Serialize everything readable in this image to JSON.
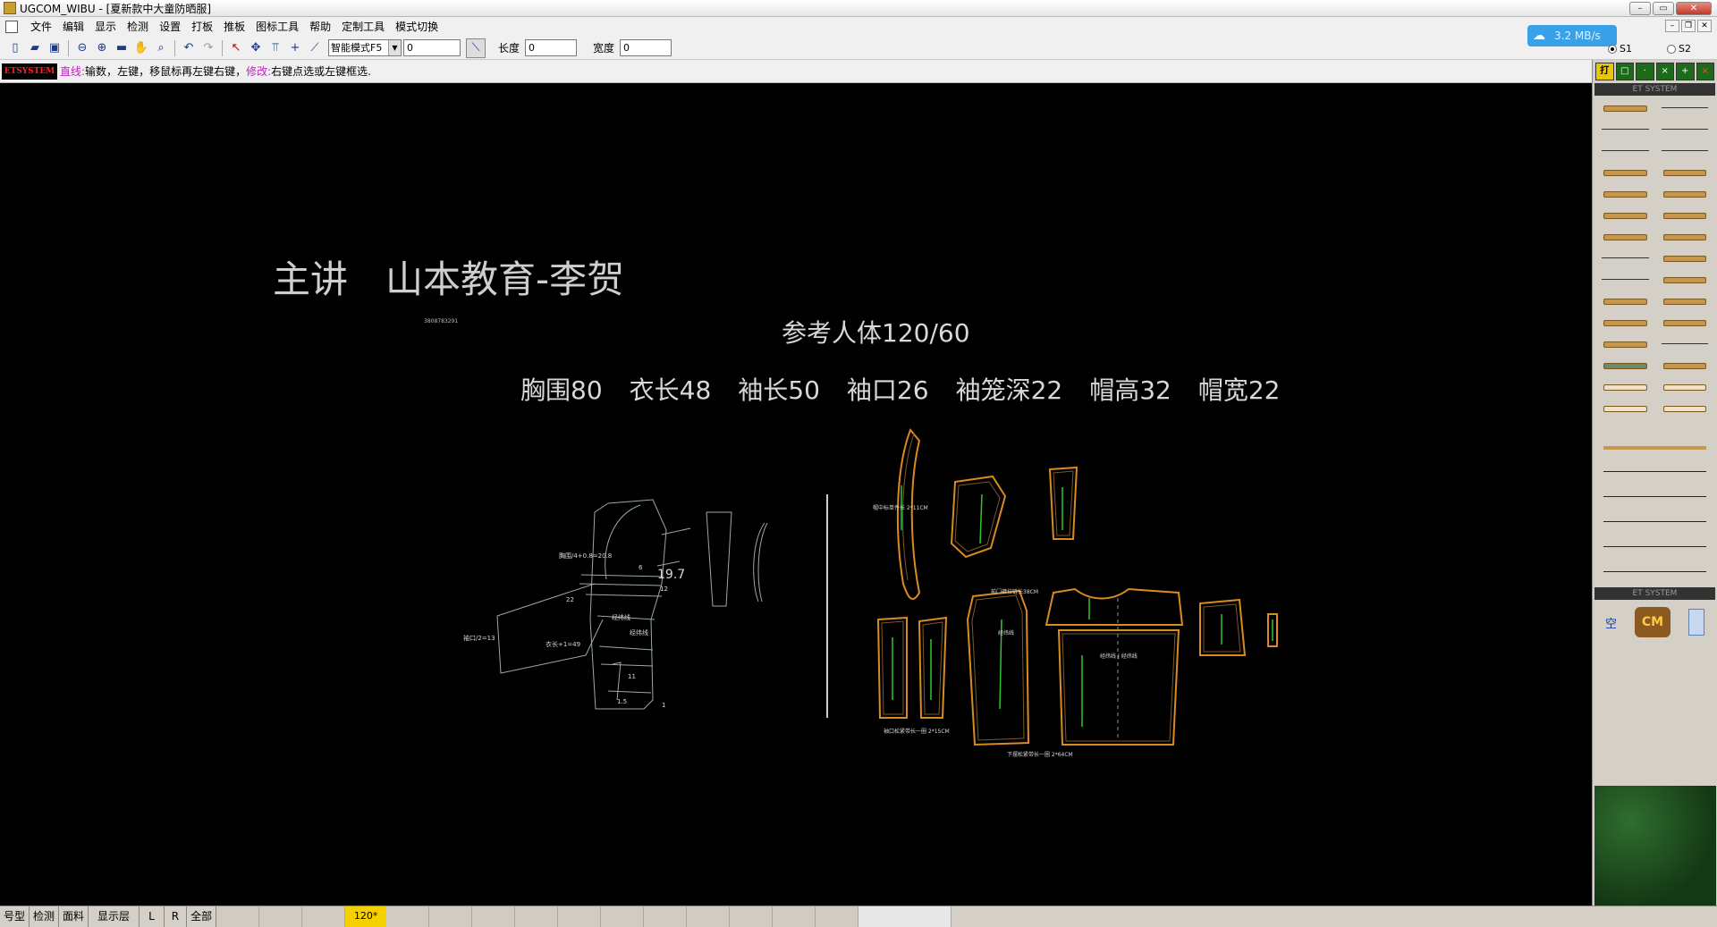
{
  "window": {
    "title": "UGCOM_WIBU - [夏新款中大童防晒服]"
  },
  "menu": [
    "文件",
    "编辑",
    "显示",
    "检测",
    "设置",
    "打板",
    "推板",
    "图标工具",
    "帮助",
    "定制工具",
    "模式切换"
  ],
  "toolbar": {
    "mode_select": "智能模式F5",
    "mode_value": "0",
    "length_label": "长度",
    "length_value": "0",
    "width_label": "宽度",
    "width_value": "0"
  },
  "network": {
    "speed": "3.2 MB/s"
  },
  "radio": {
    "s1": "S1",
    "s2": "S2"
  },
  "prompt": {
    "logo": "ETSYSTEM",
    "tool": "直线:",
    "p1": " 输数，",
    "p2": "左键",
    "p3": "，移鼠标再左键右键，",
    "modify": "修改:",
    "p4": " 右键点选或左键框选."
  },
  "canvas": {
    "lecturer": "主讲　山本教育-李贺",
    "small_num": "3808783291",
    "body_ref": "参考人体120/60",
    "measurements": [
      "胸围80",
      "衣长48",
      "袖长50",
      "袖口26",
      "袖笼深22",
      "帽高32",
      "帽宽22"
    ],
    "draft_labels": {
      "chest": "胸围/4+0.8=20.8",
      "cuff": "袖口/2=13",
      "sleeve": "衣长+1=49",
      "v197": "19.7",
      "v6": "6",
      "v12": "12",
      "v22": "22",
      "v11": "11",
      "v1_5": "1.5",
      "v1": "1",
      "grain1": "经纬线",
      "grain2": "经纬线"
    },
    "piece_labels": {
      "hood": "帽中标单件长  2*11CM",
      "front_zip": "前门襟拉链长38CM",
      "cuff_band": "袖口松紧带长一圈  2*15CM",
      "hem_band": "下摆松紧带长一圈  2*64CM",
      "back": "经纬线 | 经纬线",
      "front": "经纬线"
    }
  },
  "rightpanel": {
    "top_buttons": [
      "打",
      "□",
      "·",
      "×",
      "+",
      "×"
    ],
    "hdr1": "ET SYSTEM",
    "hdr2": "ET SYSTEM",
    "blank_label": "空",
    "cm_label": "CM"
  },
  "status": {
    "items": [
      "号型",
      "检测",
      "面料",
      "显示层",
      "L",
      "R",
      "全部"
    ],
    "zoom": "120*"
  }
}
